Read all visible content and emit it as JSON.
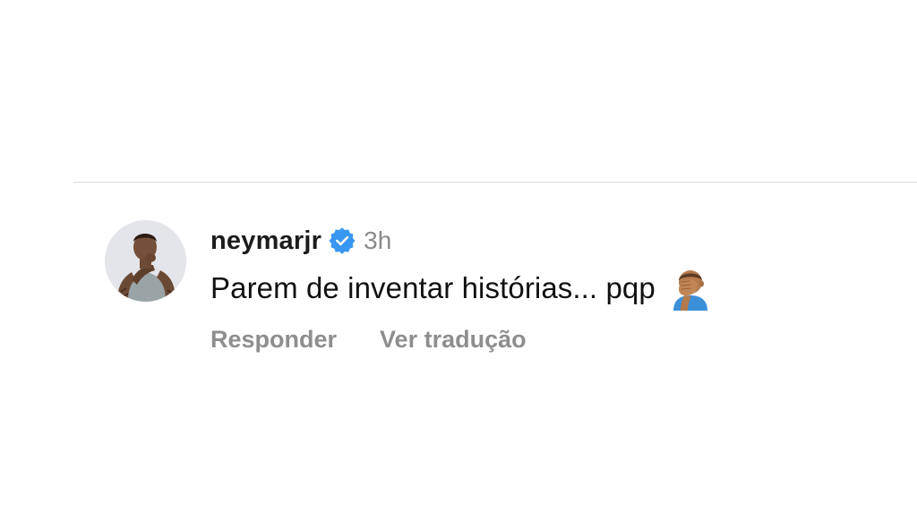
{
  "comment": {
    "username": "neymarjr",
    "verified": true,
    "timestamp": "3h",
    "text": "Parem de inventar histórias... pqp",
    "emoji": "man-facepalming-medium-skin-tone",
    "actions": {
      "reply_label": "Responder",
      "translate_label": "Ver tradução"
    }
  },
  "colors": {
    "verified_badge": "#3897f0",
    "username": "#1c1c1c",
    "secondary_text": "#8e8e8e",
    "divider": "#dbdbdb"
  }
}
